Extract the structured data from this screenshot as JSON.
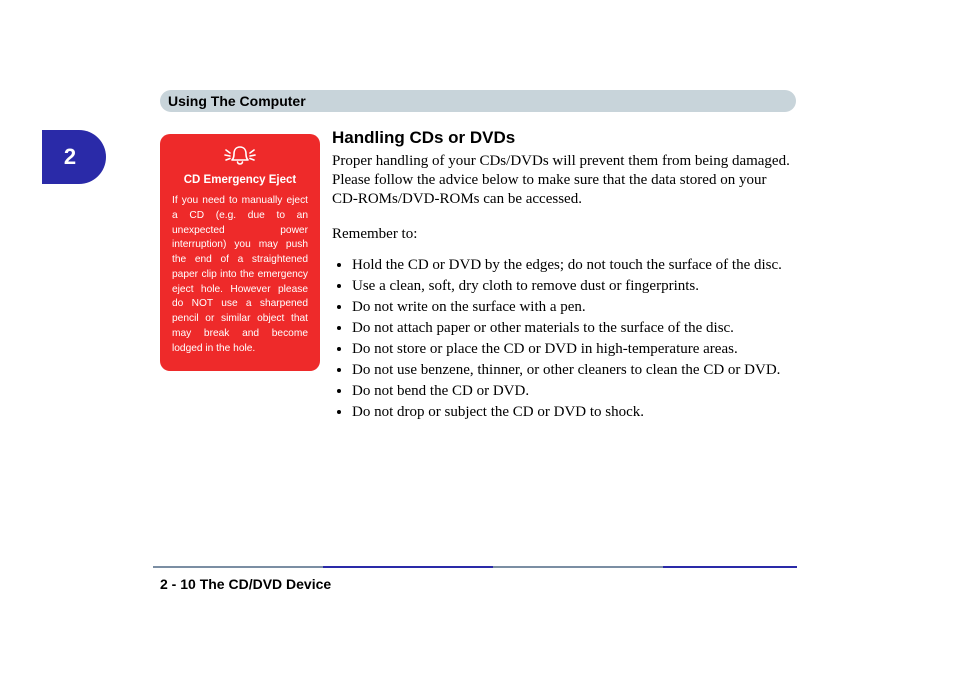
{
  "header": {
    "title": "Using The Computer"
  },
  "chapter": {
    "number": "2"
  },
  "warning": {
    "title": "CD Emergency Eject",
    "body": "If you need to manually eject a CD (e.g. due to an unexpected power interruption) you may push the end of a straightened paper clip into the emergency eject hole. However please do NOT use a sharpened pencil or similar object that may break and become lodged in the hole."
  },
  "main": {
    "heading": "Handling CDs or DVDs",
    "intro": "Proper handling of your CDs/DVDs will prevent them from being damaged. Please follow the advice below to make sure that the data stored on your CD-ROMs/DVD-ROMs can be accessed.",
    "remember": "Remember to:",
    "bullets": [
      "Hold the CD or DVD by the edges; do not touch the surface of the disc.",
      "Use a clean, soft, dry cloth to remove dust or fingerprints.",
      "Do not write on the surface with a pen.",
      "Do not attach paper or other materials to the surface of the disc.",
      "Do not store or place the CD or DVD in high-temperature areas.",
      "Do not use benzene, thinner, or other cleaners to clean the CD or DVD.",
      "Do not bend the CD or DVD.",
      "Do not drop or subject the CD or DVD to shock."
    ]
  },
  "footer": {
    "text": "2  -  10  The CD/DVD Device"
  },
  "colors": {
    "headerBar": "#c8d4da",
    "chapterTab": "#2a2aa8",
    "warningBox": "#ee2a2a"
  }
}
